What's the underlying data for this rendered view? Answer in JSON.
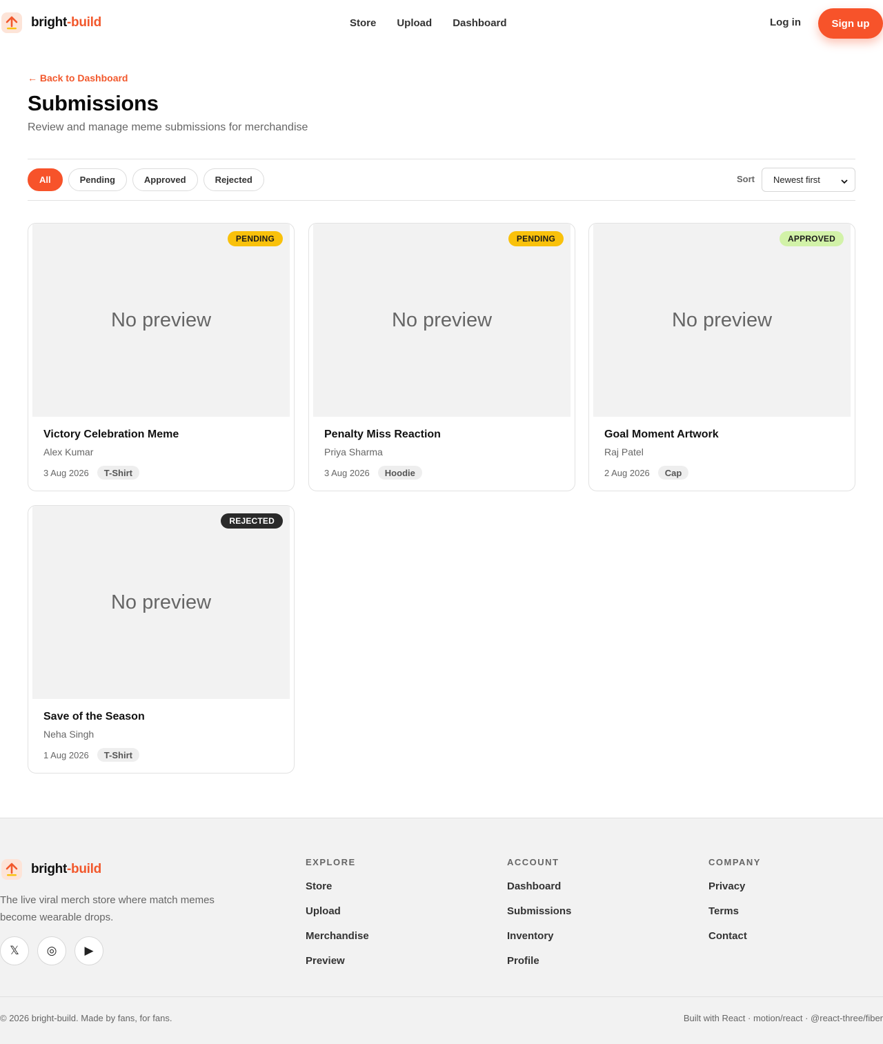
{
  "header": {
    "brand_part1": "bright",
    "brand_part2": "-build",
    "nav": [
      "Store",
      "Upload",
      "Dashboard"
    ],
    "login": "Log in",
    "signup": "Sign up"
  },
  "page": {
    "back_link": "← Back to Dashboard",
    "title": "Submissions",
    "subtitle": "Review and manage meme submissions for merchandise"
  },
  "filters": {
    "chips": [
      "All",
      "Pending",
      "Approved",
      "Rejected"
    ],
    "active": "All",
    "sort_label": "Sort",
    "sort_value": "Newest first"
  },
  "submissions": [
    {
      "status": "PENDING",
      "preview": "No preview",
      "title": "Victory Celebration Meme",
      "author": "Alex Kumar",
      "date": "3 Aug 2026",
      "product": "T-Shirt"
    },
    {
      "status": "PENDING",
      "preview": "No preview",
      "title": "Penalty Miss Reaction",
      "author": "Priya Sharma",
      "date": "3 Aug 2026",
      "product": "Hoodie"
    },
    {
      "status": "APPROVED",
      "preview": "No preview",
      "title": "Goal Moment Artwork",
      "author": "Raj Patel",
      "date": "2 Aug 2026",
      "product": "Cap"
    },
    {
      "status": "REJECTED",
      "preview": "No preview",
      "title": "Save of the Season",
      "author": "Neha Singh",
      "date": "1 Aug 2026",
      "product": "T-Shirt"
    }
  ],
  "colors": {
    "accent": "#f7532a",
    "pending": "#f9c10b",
    "approved": "#d2f2a8",
    "rejected": "#2a2a2a"
  },
  "footer": {
    "brand_part1": "bright",
    "brand_part2": "-build",
    "tagline": "The live viral merch store where match memes become wearable drops.",
    "socials": [
      {
        "icon": "x-icon",
        "glyph": "𝕏"
      },
      {
        "icon": "instagram-icon",
        "glyph": "◎"
      },
      {
        "icon": "youtube-icon",
        "glyph": "▶"
      }
    ],
    "columns": [
      {
        "heading": "EXPLORE",
        "links": [
          "Store",
          "Upload",
          "Merchandise",
          "Preview"
        ]
      },
      {
        "heading": "ACCOUNT",
        "links": [
          "Dashboard",
          "Submissions",
          "Inventory",
          "Profile"
        ]
      },
      {
        "heading": "COMPANY",
        "links": [
          "Privacy",
          "Terms",
          "Contact"
        ]
      }
    ],
    "copyright": "© 2026 bright-build. Made by fans, for fans.",
    "built_with": "Built with React · motion/react · @react-three/fiber"
  }
}
